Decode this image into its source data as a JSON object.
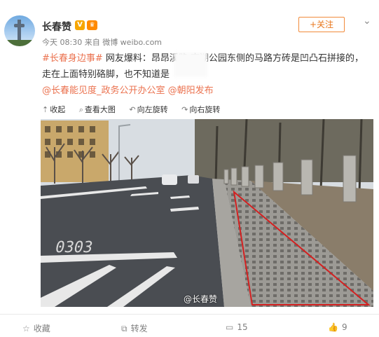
{
  "post": {
    "username": "长春赞",
    "verified_badge": "V",
    "member_badge": "♛",
    "meta": "今天 08:30 来自 微博 weibo.com",
    "follow_label": "+关注",
    "line1_topic": "#长春身边事#",
    "line1_text": " 网友爆料：昂昂溪路                         南湖公园东侧的马路方砖是凹凸石拼接的，",
    "line2_text": "走在上面特别硌脚，也不知道是",
    "line3_mention1": "@长春能见度_政务公开办公室",
    "line3_mention2": " @朝阳发布"
  },
  "image_toolbar": {
    "collapse": "收起",
    "view_large": "查看大图",
    "rotate_left": "向左旋转",
    "rotate_right": "向右旋转"
  },
  "photo": {
    "like_count": "9",
    "road_marking": "0303",
    "watermark": "@长春赞"
  },
  "footer": {
    "favorite": "收藏",
    "repost": "转发",
    "comments": "15",
    "likes": "9"
  },
  "icons": {
    "favorite": "star-icon",
    "repost": "repost-icon",
    "comment": "comment-icon",
    "like": "thumbs-up-icon"
  },
  "colors": {
    "link": "#eb7350",
    "follow": "#e8751a",
    "highlight": "#d42020"
  }
}
